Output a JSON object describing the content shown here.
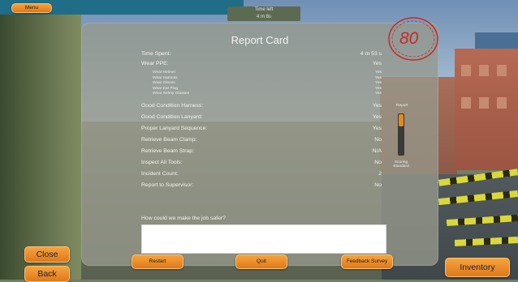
{
  "hud": {
    "menu_label": "Menu",
    "time_left_label": "Time left",
    "time_left_value": "4 m 8s",
    "close_label": "Close",
    "back_label": "Back",
    "inventory_label": "Inventory"
  },
  "report": {
    "title": "Report Card",
    "score": "80",
    "rows": [
      {
        "label": "Time Spent:",
        "value": "4 m 53 s"
      },
      {
        "label": "Wear PPE:",
        "value": "Yes"
      },
      {
        "label": "Wear Helmet",
        "value": "Yes",
        "sub": true
      },
      {
        "label": "Wear Harness",
        "value": "Yes",
        "sub": true
      },
      {
        "label": "Wear Gloves",
        "value": "Yes",
        "sub": true
      },
      {
        "label": "Wear Ear Plug",
        "value": "Yes",
        "sub": true
      },
      {
        "label": "Wear Safety Glasses",
        "value": "Yes",
        "sub": true
      },
      {
        "label": "Good Condition Harness:",
        "value": "Yes"
      },
      {
        "label": "Good Condition Lanyard:",
        "value": "Yes"
      },
      {
        "label": "Proper Lanyard Sequence:",
        "value": "Yes"
      },
      {
        "label": "Retrieve Beam Clamp:",
        "value": "No"
      },
      {
        "label": "Retrieve Beam Strap:",
        "value": "N/A"
      },
      {
        "label": "Inspect All Tools:",
        "value": "No"
      },
      {
        "label": "Incident Count:",
        "value": "2"
      },
      {
        "label": "Report to Supervisor:",
        "value": "No"
      }
    ],
    "question": "How could we make the job safer?",
    "feedback_value": "",
    "meter_top_label": "Report",
    "meter_bottom_label": "Scoring Standard",
    "meter_level": 0.3,
    "restart_label": "Restart",
    "quit_label": "Quit",
    "survey_label": "Feedback Survey"
  },
  "colors": {
    "button_orange": "#f29a34",
    "stamp_red": "#c22a2a",
    "panel_bg": "#96988c"
  }
}
